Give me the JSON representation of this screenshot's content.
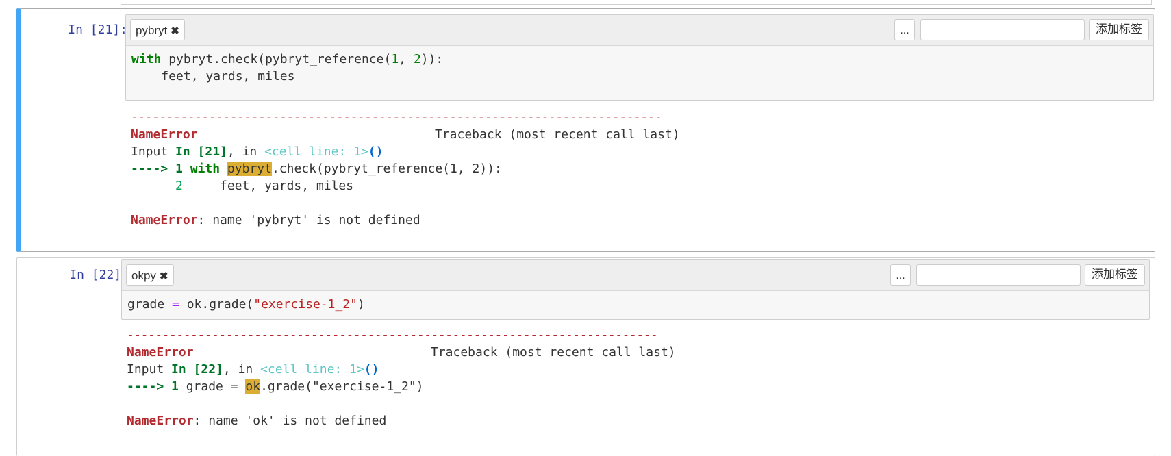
{
  "colors": {
    "accent": "#42a5f5",
    "error": "#b22b31",
    "highlight": "#dbae33"
  },
  "tag_ui": {
    "more_label": "...",
    "add_label": "添加标签",
    "remove_glyph": "✖"
  },
  "separator": "---------------------------------------------------------------------------",
  "cells": [
    {
      "prompt": "In [21]:",
      "tag": "pybryt",
      "code": {
        "l1_kw": "with",
        "l1_a": " pybryt.check(pybryt_reference(",
        "l1_n1": "1",
        "l1_b": ", ",
        "l1_n2": "2",
        "l1_c": ")):",
        "l2": "    feet, yards, miles"
      },
      "traceback": {
        "error_name": "NameError",
        "header_right": "Traceback (most recent call last)",
        "input_prefix": "Input ",
        "input_ref": "In [21]",
        "input_mid": ", in ",
        "cell_loc": "<cell line: 1>",
        "parens": "()",
        "arrow": "----> 1 ",
        "arrow_kw": "with",
        "arrow_sp": " ",
        "arrow_hl": "pybryt",
        "arrow_rest": ".check(pybryt_reference(1, 2)):",
        "line2_no": "      2",
        "line2_rest": "     feet, yards, miles",
        "final_name": "NameError",
        "final_msg": ": name 'pybryt' is not defined"
      }
    },
    {
      "prompt": "In [22]:",
      "tag": "okpy",
      "code": {
        "l1_a": "grade ",
        "l1_op": "=",
        "l1_b": " ok.grade(",
        "l1_str": "\"exercise-1_2\"",
        "l1_c": ")"
      },
      "traceback": {
        "error_name": "NameError",
        "header_right": "Traceback (most recent call last)",
        "input_prefix": "Input ",
        "input_ref": "In [22]",
        "input_mid": ", in ",
        "cell_loc": "<cell line: 1>",
        "parens": "()",
        "arrow": "----> 1 ",
        "arrow_pre": "grade = ",
        "arrow_hl": "ok",
        "arrow_rest": ".grade(\"exercise-1_2\")",
        "final_name": "NameError",
        "final_msg": ": name 'ok' is not defined"
      }
    }
  ]
}
